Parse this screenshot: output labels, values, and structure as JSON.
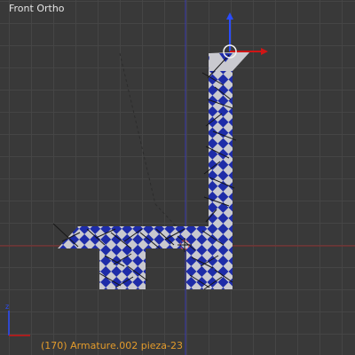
{
  "viewport": {
    "view_name": "Front Ortho",
    "status_text": "(170) Armature.002 pieza-23"
  },
  "colors": {
    "background": "#393939",
    "grid": "#464646",
    "x_axis": "#8a2d2d",
    "z_axis": "#3a3ab0",
    "checker_blue": "#1e2ca8",
    "checker_white": "#c9c9cf",
    "bone_line": "#161616",
    "status_text": "#e39b2b",
    "label_text": "#e6e6e6",
    "gizmo_blue": "#2a4cff",
    "gizmo_red": "#d01515",
    "selection_white": "#f2f2f2"
  },
  "icons": {
    "transform_gizmo": "transform-manipulator-icon",
    "cursor_3d": "3d-cursor-icon",
    "axis_orientation": "axis-orientation-icon"
  }
}
